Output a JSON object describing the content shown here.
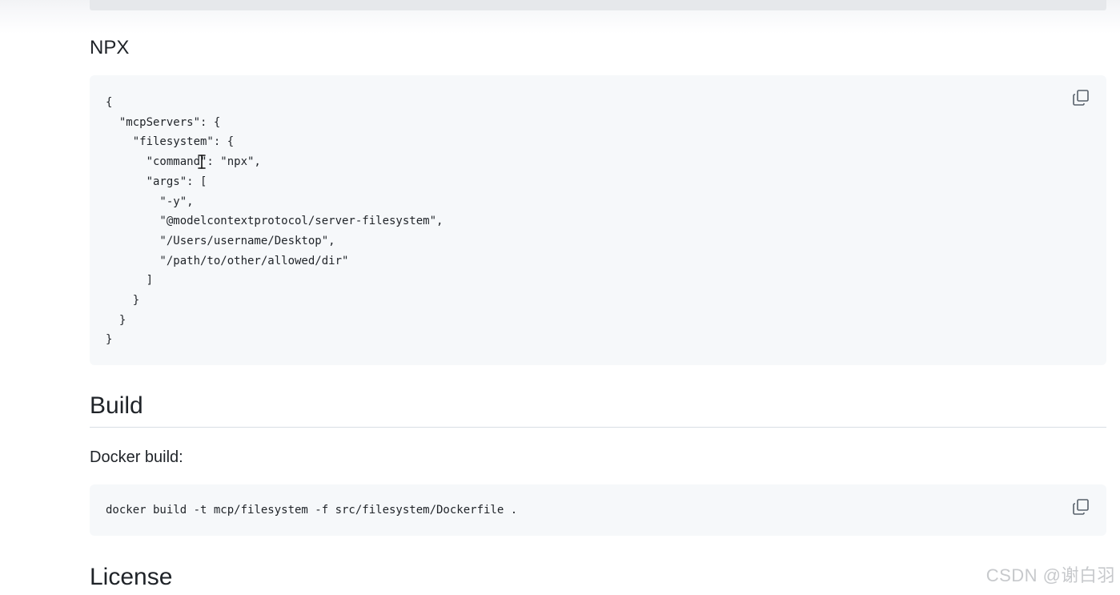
{
  "sections": {
    "npx_heading": "NPX",
    "build_heading": "Build",
    "build_text": "Docker build:",
    "license_heading": "License"
  },
  "code": {
    "json_lines": [
      "{",
      "  \"mcpServers\": {",
      "    \"filesystem\": {",
      "      \"command\": \"npx\",",
      "      \"args\": [",
      "        \"-y\",",
      "        \"@modelcontextprotocol/server-filesystem\",",
      "        \"/Users/username/Desktop\",",
      "        \"/path/to/other/allowed/dir\"",
      "      ]",
      "    }",
      "  }",
      "}"
    ],
    "docker_command": "docker build -t mcp/filesystem -f src/filesystem/Dockerfile ."
  },
  "icons": {
    "copy": "copy-icon",
    "text_cursor": "text-cursor-icon"
  },
  "watermark": "CSDN @谢白羽",
  "colors": {
    "code_background": "#f6f8fa",
    "string_color": "#0a3069",
    "text_color": "#1f2328"
  }
}
